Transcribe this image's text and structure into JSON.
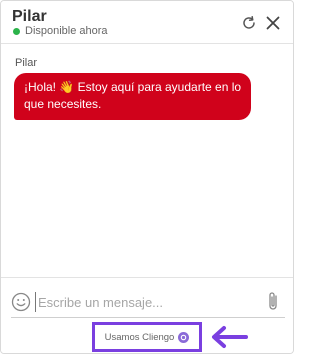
{
  "header": {
    "agent_name": "Pilar",
    "status_text": "Disponible ahora",
    "status_color": "#2bb34a",
    "refresh_icon": "refresh-icon",
    "close_icon": "close-icon"
  },
  "conversation": {
    "sender": "Pilar",
    "message": "¡Hola! 👋 Estoy aquí para ayudarte en lo que necesites.",
    "bubble_color": "#d0021b"
  },
  "composer": {
    "placeholder": "Escribe un mensaje...",
    "emoji_icon": "emoji-icon",
    "attach_icon": "paperclip-icon"
  },
  "branding": {
    "label": "Usamos Cliengo",
    "logo_icon": "cliengo-logo-icon",
    "highlight_color": "#7a3fe0"
  },
  "annotation": {
    "arrow_icon": "arrow-left-icon"
  }
}
